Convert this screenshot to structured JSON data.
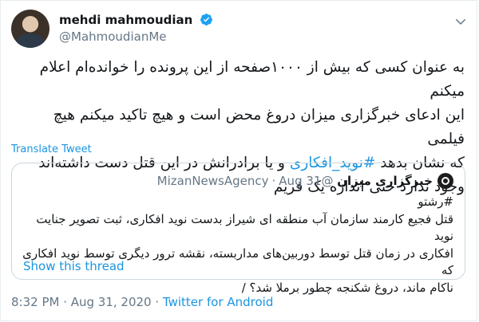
{
  "tweet": {
    "author": {
      "display_name": "mehdi mahmoudian",
      "handle": "@MahmoudianMe",
      "verified": true,
      "avatar": "profile-photo"
    },
    "text_before_hashtag": "به عنوان کسی که بیش از ۱۰۰۰صفحه از این پرونده را خوانده‌ام اعلام میکنم\nاین ادعای خبرگزاری میزان دروغ محض است و هیچ تاکید میکنم هیچ فیلمی\nکه نشان بدهد ",
    "hashtag": "#نوید_افکاری",
    "text_after_hashtag": " و یا برادرانش در این قتل دست داشته‌اند\nوجود ندارد حتی اندازه یک فریم",
    "translate_label": "Translate Tweet",
    "timestamp": "8:32 PM · Aug 31, 2020",
    "meta_separator": " · ",
    "source": "Twitter for Android"
  },
  "quote": {
    "name": "خبرگزاری میزان",
    "handle": "@MizanNewsAgency",
    "separator": "·",
    "date": "Aug 31",
    "text": "#رشتو\nقتل فجیع کارمند سازمان آب منطقه ای شیراز بدست نوید افکاری، ثبت تصویر جنایت نوید\nافکاری در زمان قتل توسط دوربین‌های مداربسته، نقشه ترور دیگری توسط نوید افکاری که\nناکام ماند، دروغ شکنجه چطور برملا شد؟ /",
    "show_thread": "Show this thread"
  },
  "colors": {
    "link": "#1b95e0",
    "muted": "#657786",
    "text": "#14171a",
    "border": "#ccd6dd"
  },
  "icons": [
    "verified-badge-icon",
    "chevron-down-icon"
  ]
}
